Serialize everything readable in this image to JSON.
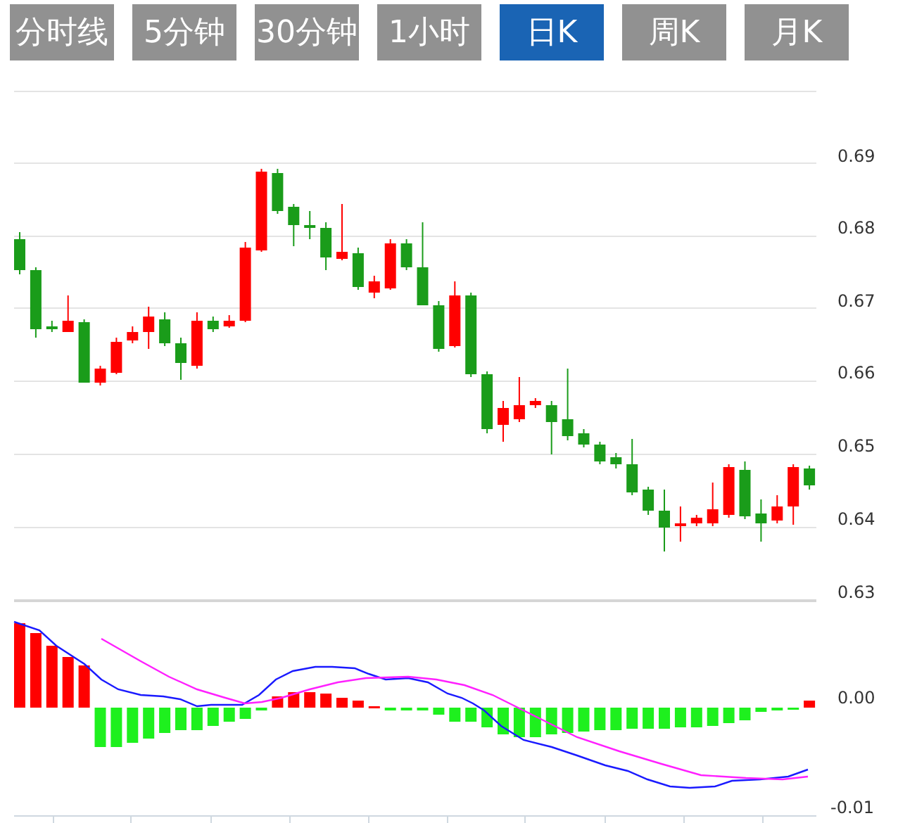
{
  "tabs": [
    {
      "label": "分时线",
      "selected": false
    },
    {
      "label": "5分钟",
      "selected": false
    },
    {
      "label": "30分钟",
      "selected": false
    },
    {
      "label": "1小时",
      "selected": false
    },
    {
      "label": "日K",
      "selected": true
    },
    {
      "label": "周K",
      "selected": false
    },
    {
      "label": "月K",
      "selected": false
    }
  ],
  "kline": {
    "y_axis_labels": [
      "0.69",
      "0.68",
      "0.67",
      "0.66",
      "0.65",
      "0.64",
      "0.63"
    ]
  },
  "macd": {
    "y_axis_labels": [
      "0.00",
      "-0.01"
    ]
  }
}
